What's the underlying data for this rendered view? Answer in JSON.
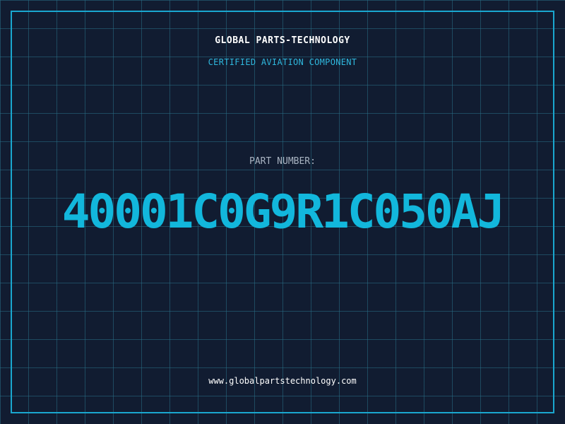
{
  "header": {
    "title": "GLOBAL PARTS-TECHNOLOGY",
    "subtitle": "CERTIFIED AVIATION COMPONENT"
  },
  "part": {
    "label": "PART NUMBER:",
    "number": "40001C0G9R1C050AJ"
  },
  "footer": {
    "website": "www.globalpartstechnology.com"
  },
  "colors": {
    "background": "#111c31",
    "grid": "#286e87",
    "frame": "#1aa7cf",
    "accent": "#12b7dc",
    "title": "#ffffff",
    "label": "#a9b4c2"
  }
}
